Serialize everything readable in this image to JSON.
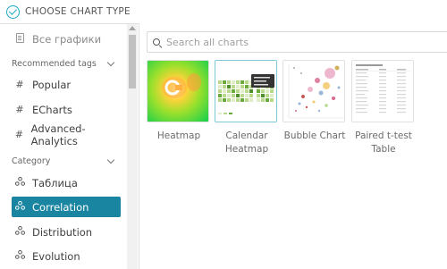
{
  "header": {
    "title": "CHOOSE CHART TYPE"
  },
  "sidebar": {
    "all_charts": "Все графики",
    "recommended_tags": {
      "title": "Recommended tags",
      "items": [
        {
          "label": "Popular",
          "icon": "hash-icon"
        },
        {
          "label": "ECharts",
          "icon": "hash-icon"
        },
        {
          "label": "Advanced-Analytics",
          "icon": "hash-icon"
        }
      ]
    },
    "category": {
      "title": "Category",
      "items": [
        {
          "label": "Таблица",
          "icon": "category-icon",
          "selected": false
        },
        {
          "label": "Correlation",
          "icon": "category-icon",
          "selected": true
        },
        {
          "label": "Distribution",
          "icon": "category-icon",
          "selected": false
        },
        {
          "label": "Evolution",
          "icon": "category-icon",
          "selected": false
        }
      ]
    }
  },
  "search": {
    "placeholder": "Search all charts",
    "value": ""
  },
  "charts": [
    {
      "label": "Heatmap",
      "selected": false
    },
    {
      "label": "Calendar Heatmap",
      "selected": true
    },
    {
      "label": "Bubble Chart",
      "selected": false
    },
    {
      "label": "Paired t-test Table",
      "selected": false
    }
  ],
  "colors": {
    "accent": "#1fa8c9",
    "selected_bg": "#1a85a0"
  }
}
